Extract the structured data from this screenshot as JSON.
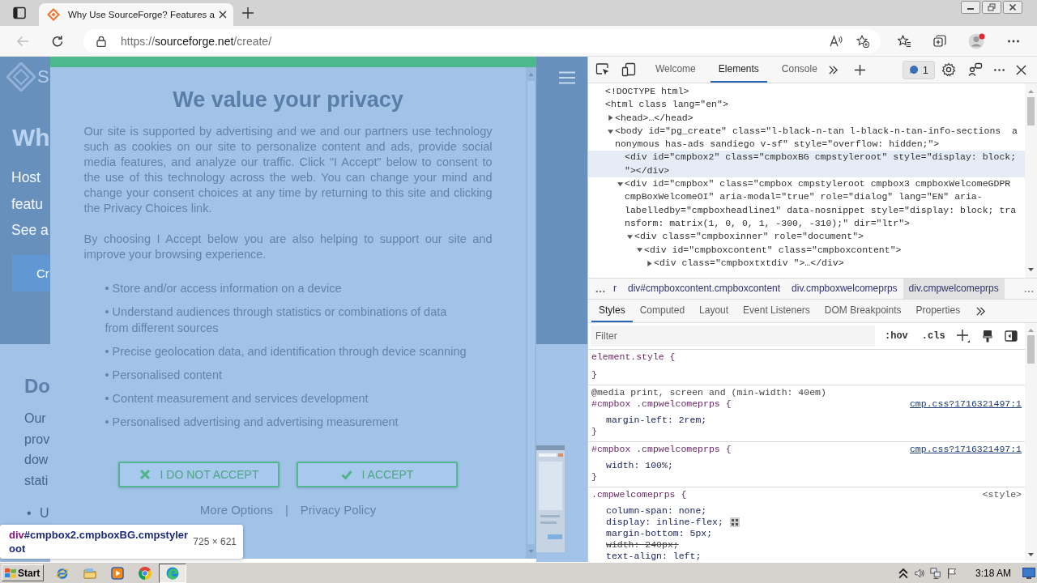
{
  "browser": {
    "tab": {
      "title": "Why Use SourceForge? Features a",
      "selected": true
    },
    "back": {
      "disabled": true
    },
    "address": {
      "scheme": "https://",
      "host": "sourceforge.net",
      "path": "/create/"
    }
  },
  "page": {
    "logo_text": "S",
    "hero": {
      "heading": "Wh",
      "lines": [
        "Host",
        "featu",
        "See a"
      ],
      "button": "Cr"
    },
    "section": {
      "heading": "Do",
      "lines": [
        "Our",
        "prov",
        "dow",
        "stati"
      ],
      "list_item": "• U"
    }
  },
  "consent_dialog": {
    "title": "We value your privacy",
    "paragraphs": [
      "Our site is supported by advertising and we and our partners use technology such as cookies on our site to personalize content and ads, provide social media features, and analyze our traffic. Click \"I Accept\" below to consent to the use of this technology across the web. You can change your mind and change your consent choices at any time by returning to this site and clicking the Privacy Choices link.",
      "By choosing I Accept below you are also helping to support our site and improve your browsing experience."
    ],
    "purposes": [
      "• Store and/or access information on a device",
      "• Understand audiences through statistics or combinations of data from different sources",
      "• Precise geolocation data, and identification through device scanning",
      "• Personalised content",
      "• Content measurement and services development",
      "• Personalised advertising and advertising measurement"
    ],
    "buttons": [
      {
        "label": "I DO NOT ACCEPT",
        "kind": "reject"
      },
      {
        "label": "I ACCEPT",
        "kind": "accept"
      }
    ],
    "links": [
      "More Options",
      "Privacy Policy"
    ],
    "separator": "|"
  },
  "inspect_tooltip": {
    "tag": "div",
    "selector": "#cmpbox2.cmpboxBG.cmpstyleroot",
    "size": "725 × 621"
  },
  "devtools": {
    "tabs": [
      {
        "label": "Welcome",
        "selected": false
      },
      {
        "label": "Elements",
        "selected": true
      },
      {
        "label": "Console",
        "selected": false
      }
    ],
    "issues": "1",
    "dom_tree": [
      {
        "lines": [
          "<!DOCTYPE html>"
        ],
        "kind": "plain",
        "selected": false
      },
      {
        "lines": [
          "<html class lang=\"en\">"
        ],
        "kind": "plain",
        "selected": false,
        "children": [
          {
            "lines": [
              "<head>…</head>"
            ],
            "kind": "toggle",
            "expanded": false,
            "selected": false
          },
          {
            "lines": [
              "<body id=\"pg_create\" class=\"l-black-n-tan l-black-n-tan-info-sections  a",
              "nonymous has-ads sandiego v-sf\" style=\"overflow: hidden;\">"
            ],
            "kind": "toggle",
            "expanded": true,
            "selected": false,
            "children": [
              {
                "lines": [
                  "<div id=\"cmpbox2\" class=\"cmpboxBG cmpstyleroot\" style=\"display: block;",
                  "\"></div>"
                ],
                "kind": "plain",
                "selected": true
              },
              {
                "lines": [
                  "<div id=\"cmpbox\" class=\"cmpbox cmpstyleroot cmpbox3 cmpboxWelcomeGDPR",
                  "cmpBoxWelcomeOI\" aria-modal=\"true\" role=\"dialog\" lang=\"EN\" aria-",
                  "labelledby=\"cmpboxheadline1\" data-nosnippet style=\"display: block; tra",
                  "nsform: matrix(1, 0, 0, 1, -300, -310);\" dir=\"ltr\">"
                ],
                "kind": "toggle",
                "expanded": true,
                "selected": false,
                "children": [
                  {
                    "lines": [
                      "<div class=\"cmpboxinner\" role=\"document\">"
                    ],
                    "kind": "toggle",
                    "expanded": true,
                    "selected": false,
                    "children": [
                      {
                        "lines": [
                          "<div id=\"cmpboxcontent\" class=\"cmpboxcontent\">"
                        ],
                        "kind": "toggle",
                        "expanded": true,
                        "selected": false,
                        "children": [
                          {
                            "lines": [
                              "<div class=\"cmpboxtxtdiv \">…</div>"
                            ],
                            "kind": "toggle",
                            "expanded": false,
                            "selected": false
                          }
                        ]
                      }
                    ]
                  }
                ]
              }
            ]
          }
        ]
      }
    ],
    "breadcrumbs": [
      {
        "label": "r",
        "selected": false
      },
      {
        "label": "div#cmpboxcontent.cmpboxcontent",
        "selected": false
      },
      {
        "label": "div.cmpboxwelcomeprps",
        "selected": false
      },
      {
        "label": "div.cmpwelcomeprps",
        "selected": true
      }
    ],
    "panel_tabs": [
      {
        "label": "Styles",
        "selected": true
      },
      {
        "label": "Computed",
        "selected": false
      },
      {
        "label": "Layout",
        "selected": false
      },
      {
        "label": "Event Listeners",
        "selected": false
      },
      {
        "label": "DOM Breakpoints",
        "selected": false
      },
      {
        "label": "Properties",
        "selected": false
      }
    ],
    "filter": {
      "placeholder": "Filter"
    },
    "filter_buttons": [
      ":hov",
      ".cls"
    ],
    "rules": [
      {
        "selector": "element.style {",
        "closing": "}"
      },
      {
        "media": "@media print, screen and (min-width: 40em)",
        "selector": "#cmpbox .cmpwelcomeprps {",
        "source": {
          "text": "cmp.css?1716321497:1",
          "kind": "link"
        },
        "properties": [
          {
            "text": "margin-left: 2rem;",
            "overridden": false,
            "kind": "plain"
          }
        ],
        "closing": "}"
      },
      {
        "selector": "#cmpbox .cmpwelcomeprps {",
        "source": {
          "text": "cmp.css?1716321497:1",
          "kind": "link"
        },
        "properties": [
          {
            "text": "width: 100%;",
            "overridden": false,
            "kind": "plain"
          }
        ],
        "closing": "}"
      },
      {
        "selector": ".cmpwelcomeprps {",
        "source": {
          "text": "<style>",
          "kind": "inline"
        },
        "properties": [
          {
            "text": "column-span: none;",
            "overridden": false,
            "kind": "plain"
          },
          {
            "text": "display: inline-flex;",
            "overridden": false,
            "kind": "flex"
          },
          {
            "text": "margin-bottom: 5px;",
            "overridden": false,
            "kind": "plain"
          },
          {
            "text": "width: 240px;",
            "overridden": true,
            "kind": "plain"
          },
          {
            "text": "text-align: left;",
            "overridden": false,
            "kind": "plain"
          }
        ]
      }
    ]
  },
  "taskbar": {
    "start": "Start",
    "apps": [
      {
        "kind": "ie",
        "selected": false
      },
      {
        "kind": "explorer",
        "selected": false
      },
      {
        "kind": "media",
        "selected": false
      },
      {
        "kind": "chrome",
        "selected": false
      },
      {
        "kind": "edge",
        "selected": true
      }
    ],
    "clock": "3:18 AM"
  }
}
